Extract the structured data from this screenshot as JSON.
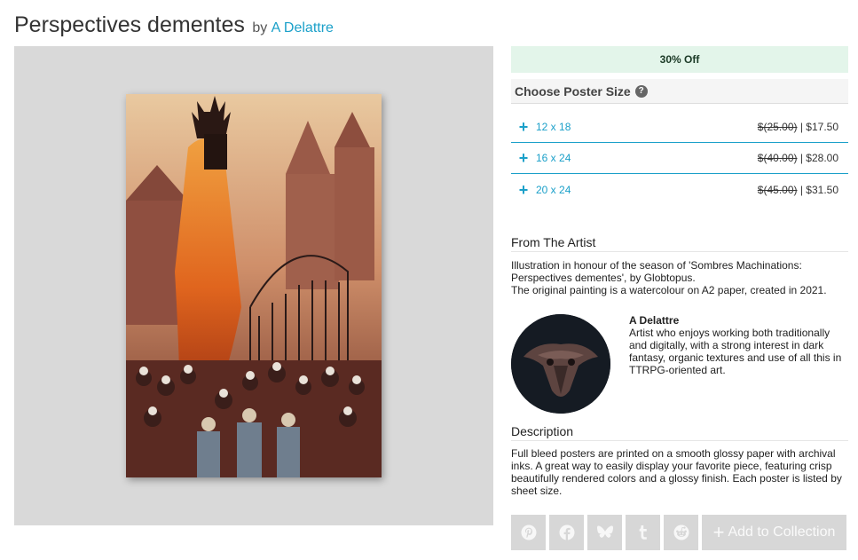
{
  "header": {
    "title": "Perspectives dementes",
    "by": "by",
    "artist": "A Delattre"
  },
  "discount_banner": "30% Off",
  "poster_sizes": {
    "heading": "Choose Poster Size",
    "help": "?",
    "options": [
      {
        "label": "12 x 18",
        "old_price": "$(25.00)",
        "sep": " | ",
        "price": "$17.50"
      },
      {
        "label": "16 x 24",
        "old_price": "$(40.00)",
        "sep": " | ",
        "price": "$28.00"
      },
      {
        "label": "20 x 24",
        "old_price": "$(45.00)",
        "sep": " | ",
        "price": "$31.50"
      }
    ]
  },
  "from_artist": {
    "heading": "From The Artist",
    "line1": "Illustration in honour of the season of 'Sombres Machinations: Perspectives dementes', by Globtopus.",
    "line2": "The original painting is a watercolour on A2 paper, created in 2021."
  },
  "artist_card": {
    "name": "A Delattre",
    "bio": "Artist who enjoys working both traditionally and digitally, with a strong interest in dark fantasy, organic textures and use of all this in TTRPG-oriented art."
  },
  "description": {
    "heading": "Description",
    "text": "Full bleed posters are printed on a smooth glossy paper with archival inks. A great way to easily display your favorite piece, featuring crisp beautifully rendered colors and a glossy finish. Each poster is listed by sheet size."
  },
  "share": {
    "icons": [
      "pinterest-icon",
      "facebook-icon",
      "bluesky-icon",
      "tumblr-icon",
      "reddit-icon"
    ],
    "collection_label": "Add to Collection"
  },
  "colors": {
    "accent": "#1ba0c9",
    "discount_bg": "#e3f5ea",
    "button_bg": "#d7d7d7"
  }
}
